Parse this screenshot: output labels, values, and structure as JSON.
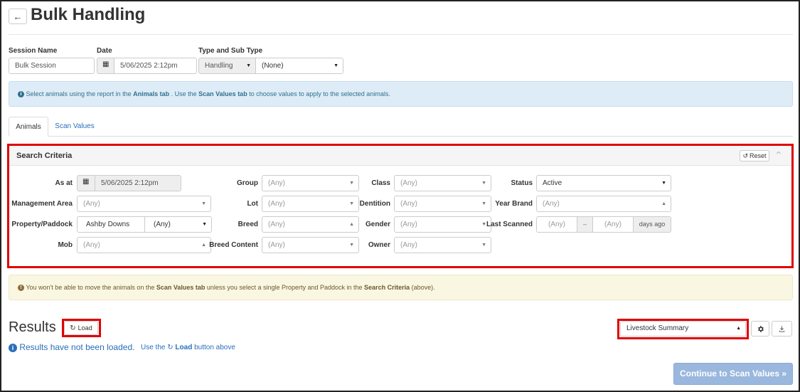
{
  "page": {
    "title": "Bulk Handling"
  },
  "session": {
    "session_name_label": "Session Name",
    "session_name_value": "Bulk Session",
    "date_label": "Date",
    "date_value": "5/06/2025 2:12pm",
    "type_label": "Type and Sub Type",
    "type_value": "Handling",
    "subtype_value": "(None)"
  },
  "info_banner": {
    "pre": "Select animals using the report in the ",
    "link1": "Animals tab",
    "mid": " . Use the ",
    "link2": "Scan Values tab",
    "post": " to choose values to apply to the selected animals."
  },
  "tabs": [
    {
      "label": "Animals",
      "active": true
    },
    {
      "label": "Scan Values",
      "active": false
    }
  ],
  "search_criteria": {
    "title": "Search Criteria",
    "reset_label": "Reset",
    "as_at_label": "As at",
    "as_at_value": "5/06/2025 2:12pm",
    "management_area_label": "Management Area",
    "management_area_value": "(Any)",
    "property_paddock_label": "Property/Paddock",
    "property_value": "Ashby Downs",
    "paddock_value": "(Any)",
    "mob_label": "Mob",
    "mob_value": "(Any)",
    "group_label": "Group",
    "group_value": "(Any)",
    "lot_label": "Lot",
    "lot_value": "(Any)",
    "breed_label": "Breed",
    "breed_value": "(Any)",
    "breed_content_label": "Breed Content",
    "breed_content_value": "(Any)",
    "class_label": "Class",
    "class_value": "(Any)",
    "dentition_label": "Dentition",
    "dentition_value": "(Any)",
    "gender_label": "Gender",
    "gender_value": "(Any)",
    "owner_label": "Owner",
    "owner_value": "(Any)",
    "status_label": "Status",
    "status_value": "Active",
    "year_brand_label": "Year Brand",
    "year_brand_value": "(Any)",
    "last_scanned_label": "Last Scanned",
    "last_scanned_from": "(Any)",
    "last_scanned_sep": "–",
    "last_scanned_to": "(Any)",
    "last_scanned_suffix": "days ago"
  },
  "warning_banner": {
    "pre": "You won't be able to move the animals on the ",
    "link1": "Scan Values tab",
    "mid": " unless you select a single Property and Paddock in the ",
    "link2": "Search Criteria",
    "post": " (above)."
  },
  "results": {
    "title": "Results",
    "load_label": "Load",
    "not_loaded_text": "Results have not been loaded.",
    "use_the": "Use the",
    "load_link": "Load",
    "button_above": "button above",
    "report_value": "Livestock Summary",
    "continue_label": "Continue to Scan Values"
  },
  "colors": {
    "accent": "#2a6ebb",
    "highlight": "#e00000",
    "info_bg": "#ddecf7",
    "warning_bg": "#f9f6e2",
    "continue_bg": "#9ab7de"
  }
}
